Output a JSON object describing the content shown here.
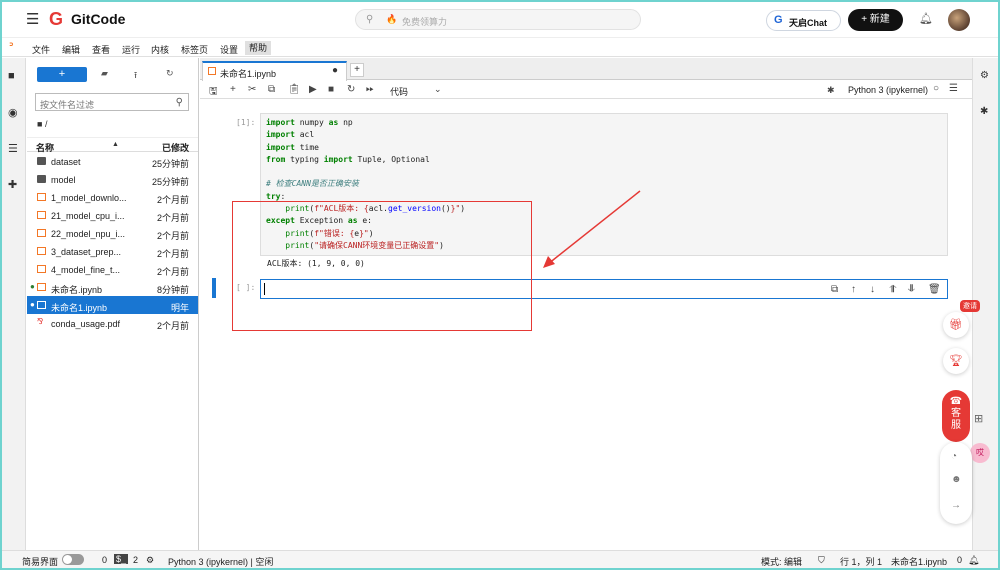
{
  "topbar": {
    "logo_icon": "G",
    "logo_text": "GitCode",
    "search_placeholder": "免费领算力",
    "chat_icon": "G",
    "chat_label": "天启Chat",
    "new_label": "+ 新建"
  },
  "menu": {
    "items": [
      "文件",
      "编辑",
      "查看",
      "运行",
      "内核",
      "标签页",
      "设置",
      "帮助"
    ]
  },
  "filebrowser": {
    "new_label": "+",
    "filter_placeholder": "按文件名过滤",
    "breadcrumb": "/",
    "col_name": "名称",
    "col_modified": "已修改",
    "files": [
      {
        "name": "dataset",
        "modified": "25分钟前",
        "type": "folder",
        "running": false,
        "selected": false
      },
      {
        "name": "model",
        "modified": "25分钟前",
        "type": "folder",
        "running": false,
        "selected": false
      },
      {
        "name": "1_model_downlo...",
        "modified": "2个月前",
        "type": "notebook",
        "running": false,
        "selected": false
      },
      {
        "name": "21_model_cpu_i...",
        "modified": "2个月前",
        "type": "notebook",
        "running": false,
        "selected": false
      },
      {
        "name": "22_model_npu_i...",
        "modified": "2个月前",
        "type": "notebook",
        "running": false,
        "selected": false
      },
      {
        "name": "3_dataset_prep...",
        "modified": "2个月前",
        "type": "notebook",
        "running": false,
        "selected": false
      },
      {
        "name": "4_model_fine_t...",
        "modified": "2个月前",
        "type": "notebook",
        "running": false,
        "selected": false
      },
      {
        "name": "未命名.ipynb",
        "modified": "8分钟前",
        "type": "notebook",
        "running": true,
        "selected": false
      },
      {
        "name": "未命名1.ipynb",
        "modified": "明年",
        "type": "notebook",
        "running": true,
        "selected": true
      },
      {
        "name": "conda_usage.pdf",
        "modified": "2个月前",
        "type": "pdf",
        "running": false,
        "selected": false
      }
    ]
  },
  "notebook": {
    "tab_title": "未命名1.ipynb",
    "cell_type": "代码",
    "kernel": "Python 3 (ipykernel)",
    "cell1_prompt": "[1]:",
    "cell2_prompt": "[ ]:",
    "code_lines": [
      [
        {
          "t": "import",
          "c": "kw"
        },
        {
          "t": " numpy ",
          "c": ""
        },
        {
          "t": "as",
          "c": "kw"
        },
        {
          "t": " np",
          "c": ""
        }
      ],
      [
        {
          "t": "import",
          "c": "kw"
        },
        {
          "t": " acl",
          "c": ""
        }
      ],
      [
        {
          "t": "import",
          "c": "kw"
        },
        {
          "t": " time",
          "c": ""
        }
      ],
      [
        {
          "t": "from",
          "c": "kw"
        },
        {
          "t": " typing ",
          "c": ""
        },
        {
          "t": "import",
          "c": "kw"
        },
        {
          "t": " Tuple, Optional",
          "c": ""
        }
      ],
      [
        {
          "t": "",
          "c": ""
        }
      ],
      [
        {
          "t": "# 检查CANN是否正确安装",
          "c": "cm"
        }
      ],
      [
        {
          "t": "try",
          "c": "kw"
        },
        {
          "t": ":",
          "c": ""
        }
      ],
      [
        {
          "t": "    ",
          "c": ""
        },
        {
          "t": "print",
          "c": "bi"
        },
        {
          "t": "(",
          "c": ""
        },
        {
          "t": "f\"ACL版本: ",
          "c": "st"
        },
        {
          "t": "{",
          "c": "st"
        },
        {
          "t": "acl.",
          "c": ""
        },
        {
          "t": "get_version",
          "c": "fn"
        },
        {
          "t": "()",
          "c": ""
        },
        {
          "t": "}\"",
          "c": "st"
        },
        {
          "t": ")",
          "c": ""
        }
      ],
      [
        {
          "t": "except",
          "c": "kw"
        },
        {
          "t": " Exception ",
          "c": ""
        },
        {
          "t": "as",
          "c": "kw"
        },
        {
          "t": " e:",
          "c": ""
        }
      ],
      [
        {
          "t": "    ",
          "c": ""
        },
        {
          "t": "print",
          "c": "bi"
        },
        {
          "t": "(",
          "c": ""
        },
        {
          "t": "f\"错误: ",
          "c": "st"
        },
        {
          "t": "{",
          "c": "st"
        },
        {
          "t": "e",
          "c": ""
        },
        {
          "t": "}\"",
          "c": "st"
        },
        {
          "t": ")",
          "c": ""
        }
      ],
      [
        {
          "t": "    ",
          "c": ""
        },
        {
          "t": "print",
          "c": "bi"
        },
        {
          "t": "(",
          "c": ""
        },
        {
          "t": "\"请确保CANN环境变量已正确设置\"",
          "c": "st"
        },
        {
          "t": ")",
          "c": ""
        }
      ]
    ],
    "output": "ACL版本: (1, 9, 0, 0)"
  },
  "floating": {
    "invite_label": "邀请",
    "support_label": "客\n服",
    "avatar_label": "哎"
  },
  "status": {
    "simple_label": "简易界面",
    "count_a": "0",
    "count_b": "2",
    "kernel_status": "Python 3 (ipykernel) | 空闲",
    "mode": "模式: 编辑",
    "position": "行 1，列 1",
    "filename": "未命名1.ipynb",
    "notifications": "0"
  },
  "colors": {
    "accent": "#1976d2",
    "brand": "#e53935",
    "jupyter": "#f37726"
  }
}
